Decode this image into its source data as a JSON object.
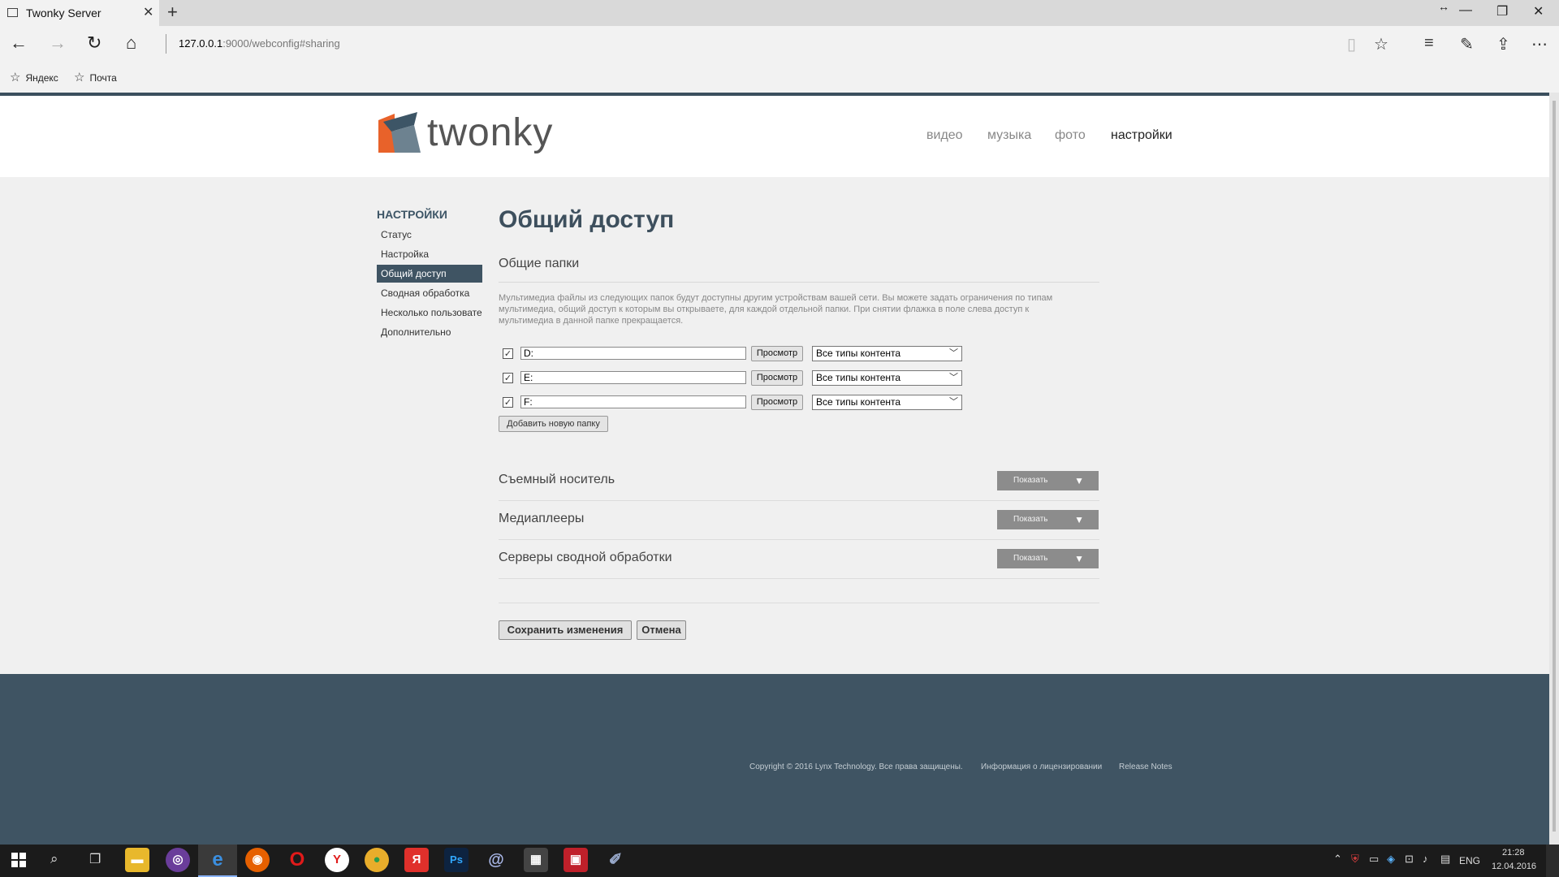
{
  "browser": {
    "tab_title": "Twonky Server",
    "url_host": "127.0.0.1",
    "url_path": ":9000/webconfig#sharing",
    "favorites": [
      "Яндекс",
      "Почта"
    ]
  },
  "header": {
    "logo_text": "twonky",
    "nav": [
      "видео",
      "музыка",
      "фото",
      "настройки"
    ]
  },
  "sidebar": {
    "title": "НАСТРОЙКИ",
    "items": [
      "Статус",
      "Настройка",
      "Общий доступ",
      "Сводная обработка",
      "Несколько пользовате",
      "Дополнительно"
    ]
  },
  "main": {
    "title": "Общий доступ",
    "subtitle": "Общие папки",
    "description": "Мультимедиа файлы из следующих папок будут доступны другим устройствам вашей сети. Вы можете задать ограничения по типам мультимедиа, общий доступ к которым вы открываете, для каждой отдельной папки. При снятии флажка в поле слева доступ к мультимедиа в данной папке прекращается.",
    "folders": [
      {
        "path": "D:",
        "checked": true,
        "browse": "Просмотр",
        "content": "Все типы контента"
      },
      {
        "path": "E:",
        "checked": true,
        "browse": "Просмотр",
        "content": "Все типы контента"
      },
      {
        "path": "F:",
        "checked": true,
        "browse": "Просмотр",
        "content": "Все типы контента"
      }
    ],
    "add_folder": "Добавить новую папку",
    "sections": [
      {
        "title": "Съемный носитель",
        "button": "Показать"
      },
      {
        "title": "Медиаплееры",
        "button": "Показать"
      },
      {
        "title": "Серверы сводной обработки",
        "button": "Показать"
      }
    ],
    "save": "Сохранить изменения",
    "cancel": "Отмена"
  },
  "footer": {
    "copyright": "Copyright © 2016 Lynx Technology. Все права защищены.",
    "license": "Информация о лицензировании",
    "release": "Release Notes"
  },
  "taskbar": {
    "lang": "ENG",
    "time": "21:28",
    "date": "12.04.2016"
  },
  "colors": {
    "accent": "#3f5463",
    "logo_orange": "#e8622a",
    "logo_dark": "#3d5566"
  }
}
